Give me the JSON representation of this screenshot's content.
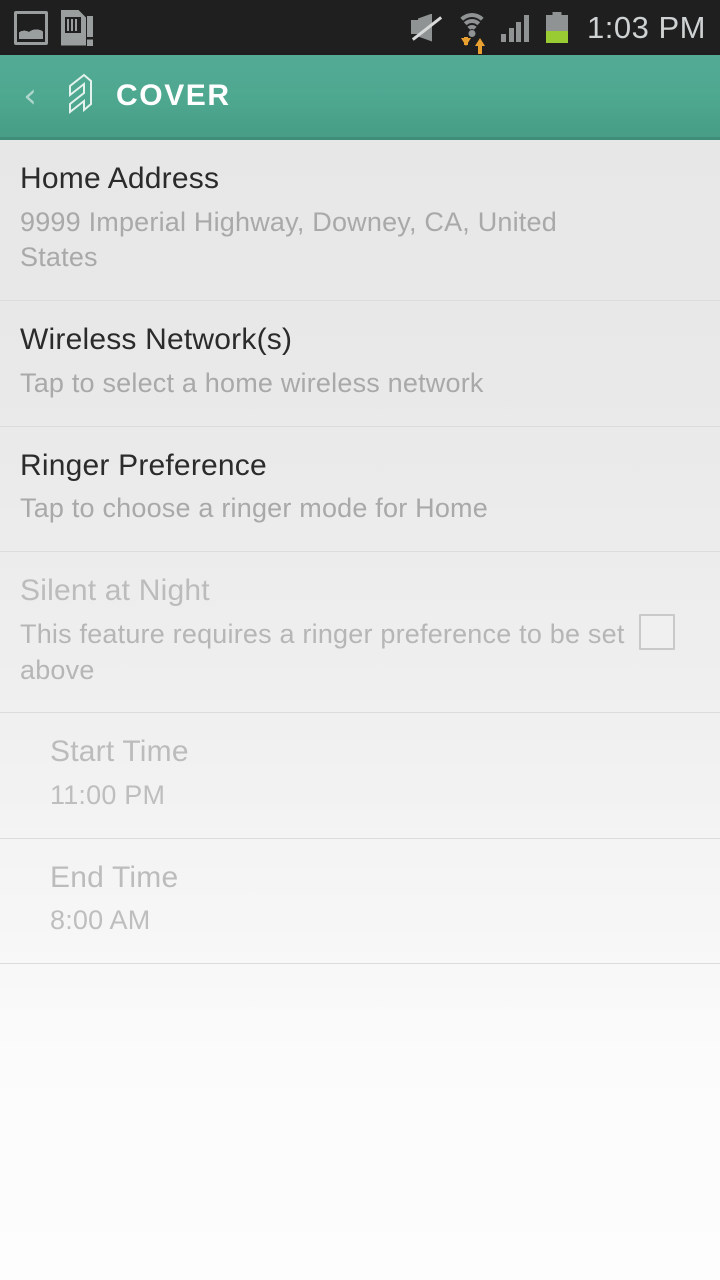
{
  "status_bar": {
    "background": "#1f1f1f",
    "clock": "1:03 PM",
    "left_icons": [
      {
        "name": "screenshot-icon",
        "label": "Screenshot captured"
      },
      {
        "name": "sd-card-icon",
        "label": "SD card"
      }
    ],
    "right_icons": [
      {
        "name": "mute-icon",
        "label": "Sound muted"
      },
      {
        "name": "wifi-icon",
        "label": "Wi-Fi connected with data activity",
        "accent": "#e8a030"
      },
      {
        "name": "cellular-signal-icon",
        "label": "Cellular signal full"
      },
      {
        "name": "battery-icon",
        "label": "Battery",
        "level_percent": 42,
        "fill_color": "#99cc33"
      }
    ]
  },
  "app_bar": {
    "back_label": "‹",
    "logo_name": "cover-logo-icon",
    "title": "COVER",
    "accent": "#4ea78f"
  },
  "list": {
    "rows": [
      {
        "name": "home-address",
        "title": "Home Address",
        "subtitle": "9999 Imperial Highway, Downey, CA, United States",
        "state": "enabled",
        "indented": false,
        "has_checkbox": false
      },
      {
        "name": "wireless-networks",
        "title": "Wireless Network(s)",
        "subtitle": "Tap to select a home wireless network",
        "state": "enabled",
        "indented": false,
        "has_checkbox": false
      },
      {
        "name": "ringer-preference",
        "title": "Ringer Preference",
        "subtitle": "Tap to choose a ringer mode for Home",
        "state": "enabled",
        "indented": false,
        "has_checkbox": false
      },
      {
        "name": "silent-at-night",
        "title": "Silent at Night",
        "subtitle": "This feature requires a ringer preference to be set above",
        "state": "disabled",
        "indented": false,
        "has_checkbox": true,
        "checked": false
      },
      {
        "name": "start-time",
        "title": "Start Time",
        "subtitle": "11:00 PM",
        "state": "disabled",
        "indented": true,
        "has_checkbox": false
      },
      {
        "name": "end-time",
        "title": "End Time",
        "subtitle": "8:00 AM",
        "state": "disabled",
        "indented": true,
        "has_checkbox": false
      }
    ]
  }
}
